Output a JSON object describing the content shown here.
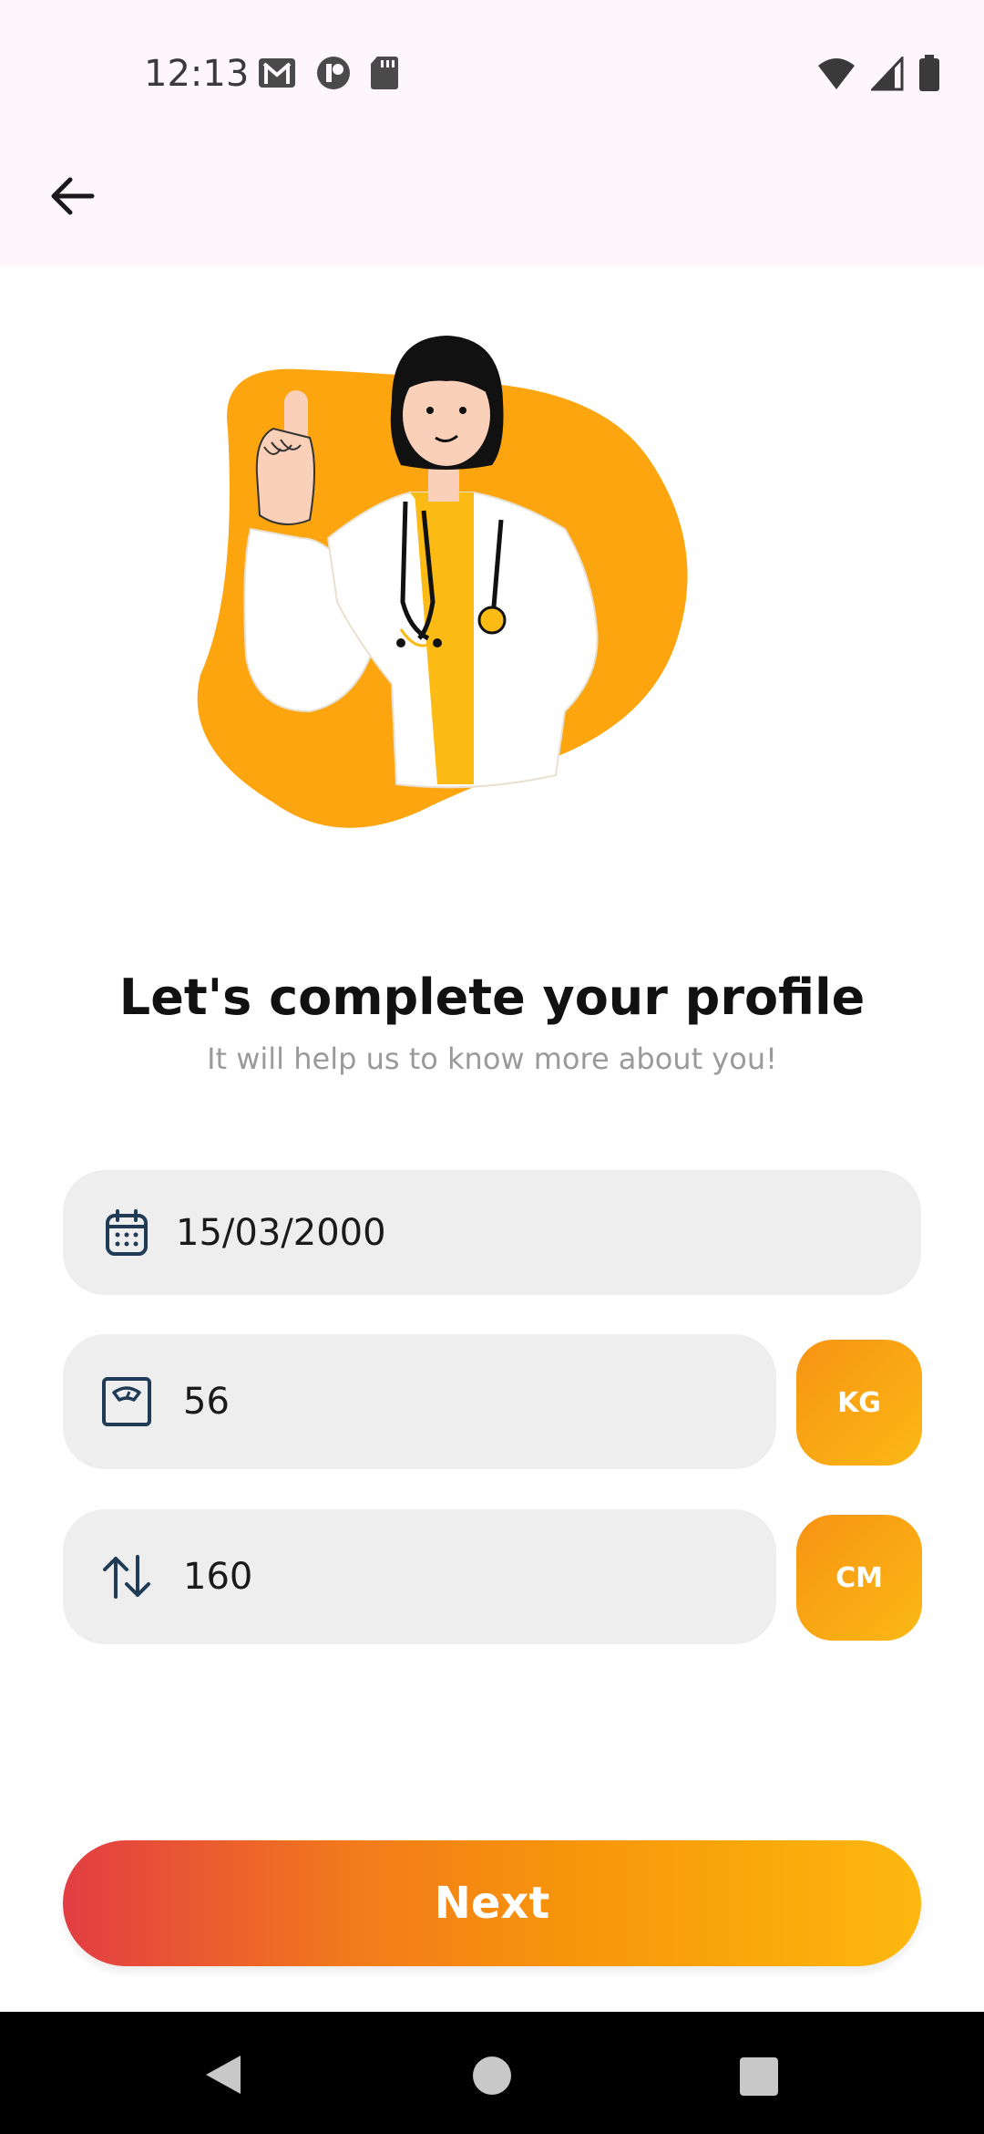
{
  "status": {
    "time": "12:13"
  },
  "header": {
    "back_icon": "arrow-left-icon"
  },
  "content": {
    "title": "Let's complete your profile",
    "subtitle": "It will help us to know more about you!"
  },
  "form": {
    "birthdate": {
      "value": "15/03/2000",
      "icon": "calendar-icon"
    },
    "weight": {
      "value": "56",
      "icon": "weight-scale-icon",
      "unit": "KG"
    },
    "height": {
      "value": "160",
      "icon": "height-arrows-icon",
      "unit": "CM"
    }
  },
  "actions": {
    "next_label": "Next"
  },
  "colors": {
    "accent": "#FDA50F",
    "gradient_start": "#E23D43",
    "gradient_end": "#FDB80F",
    "field_bg": "#EEEEEE"
  }
}
